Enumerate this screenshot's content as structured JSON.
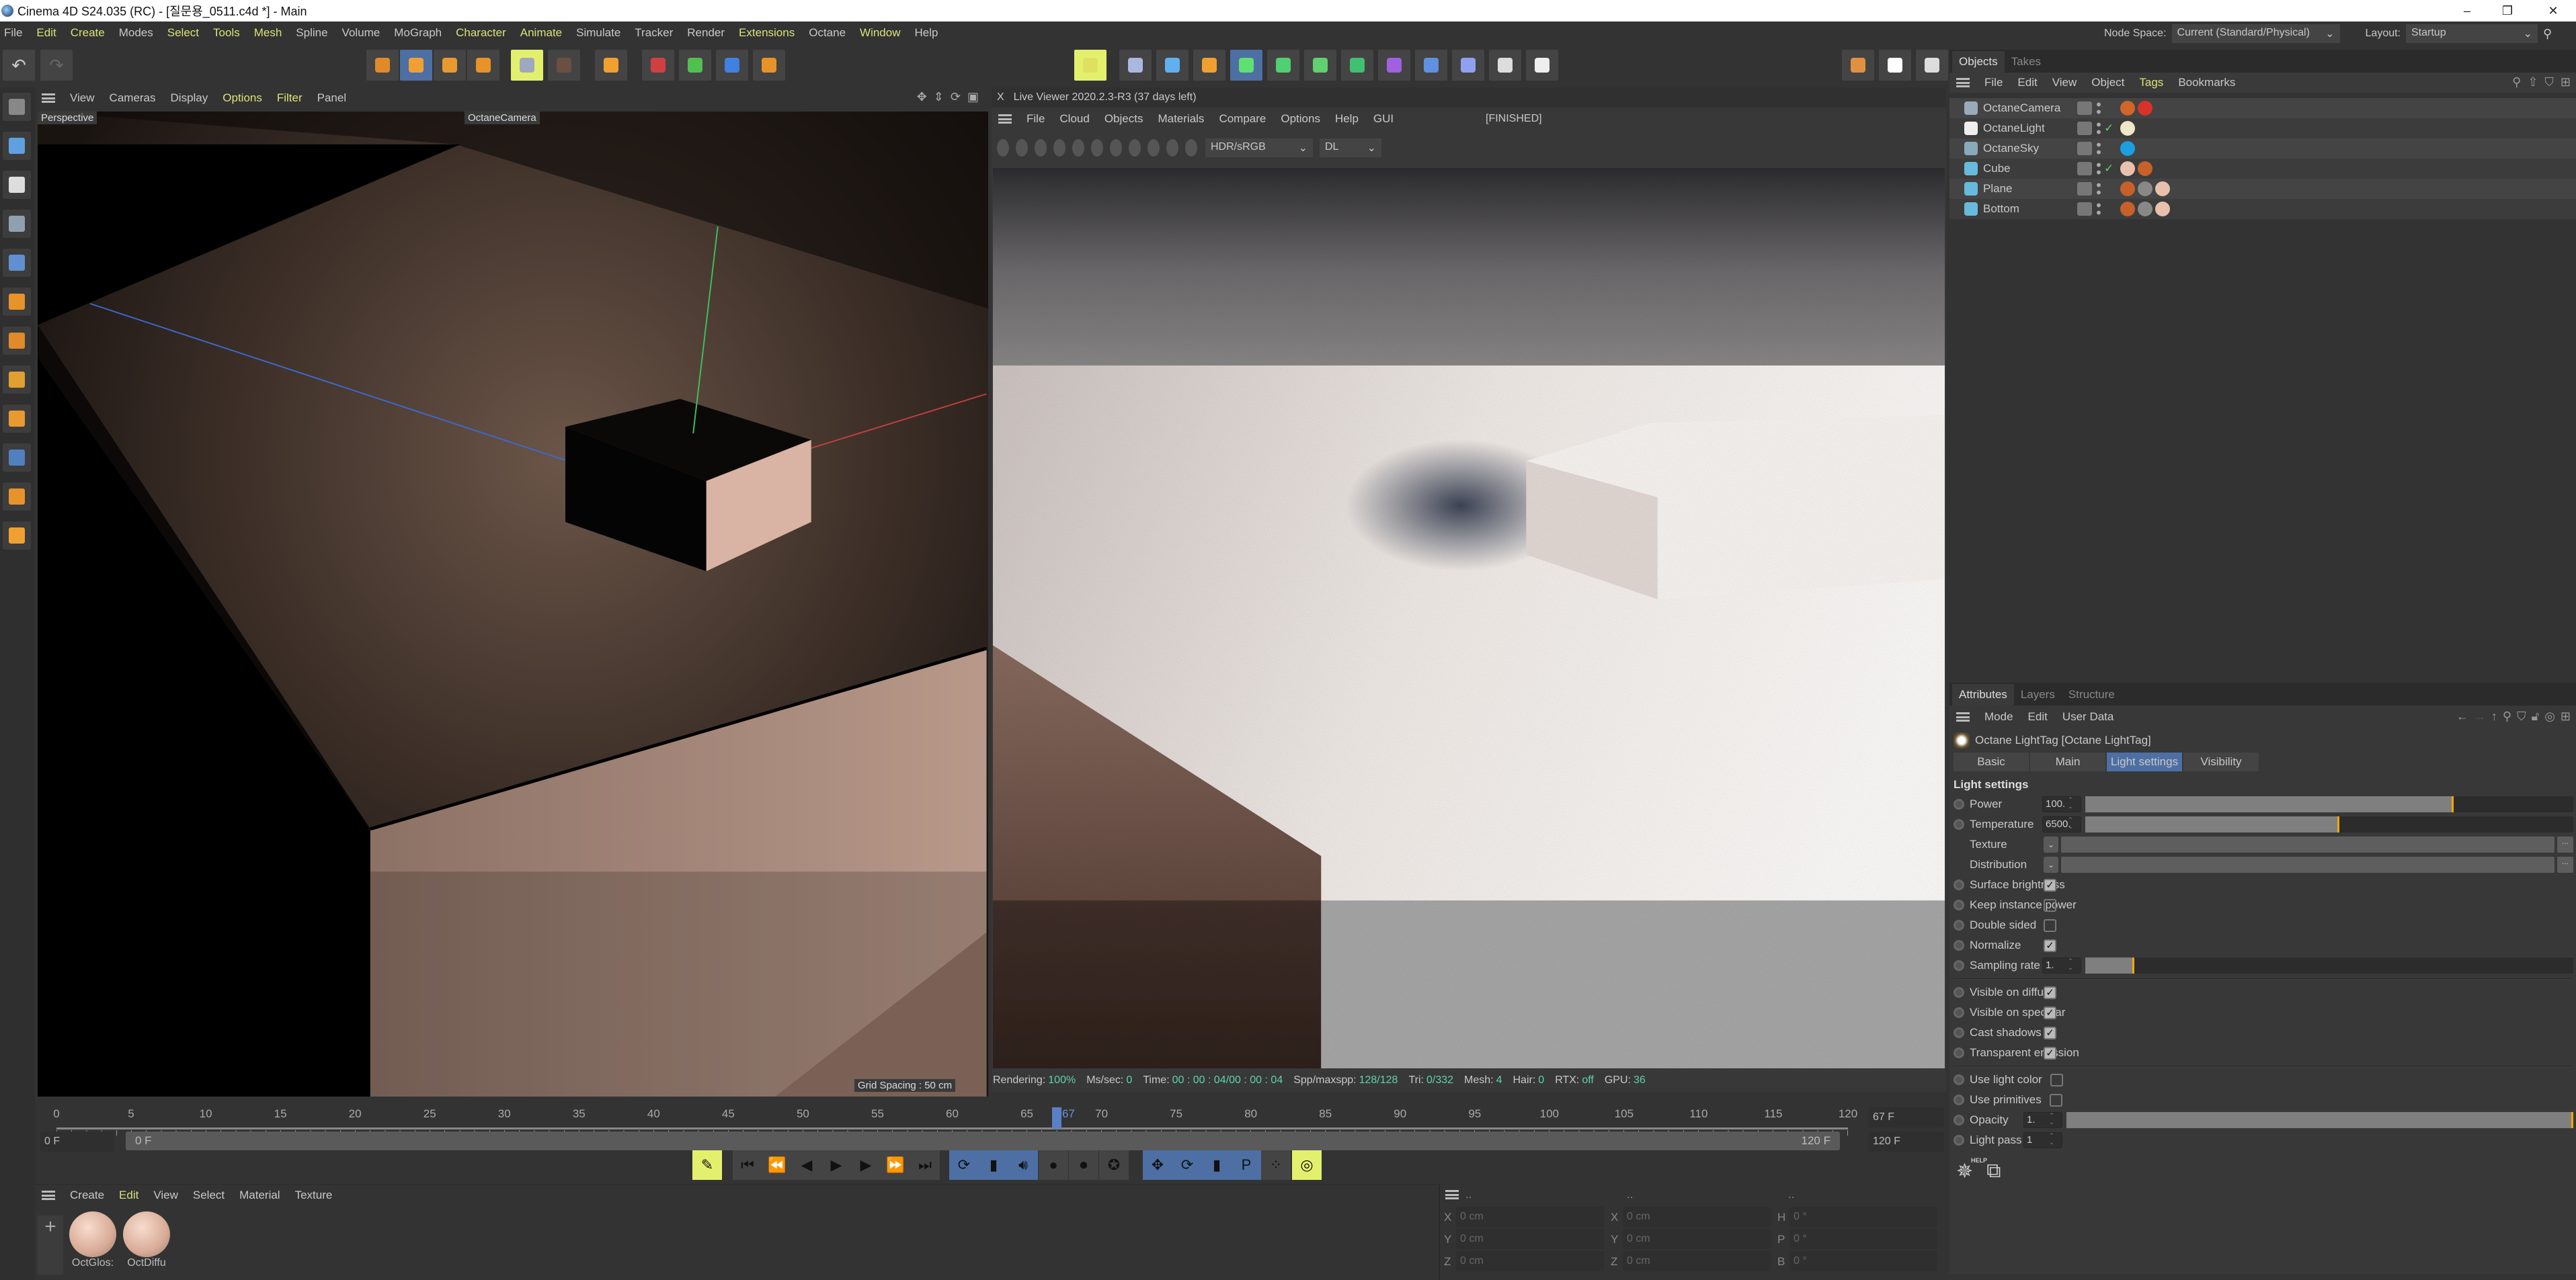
{
  "window": {
    "title": "Cinema 4D S24.035 (RC) - [질문용_0511.c4d *] - Main",
    "minimize": "–",
    "restore": "❐",
    "close": "✕"
  },
  "menu": [
    {
      "label": "File",
      "hl": false
    },
    {
      "label": "Edit",
      "hl": true
    },
    {
      "label": "Create",
      "hl": true
    },
    {
      "label": "Modes",
      "hl": false
    },
    {
      "label": "Select",
      "hl": true
    },
    {
      "label": "Tools",
      "hl": true
    },
    {
      "label": "Mesh",
      "hl": true
    },
    {
      "label": "Spline",
      "hl": false
    },
    {
      "label": "Volume",
      "hl": false
    },
    {
      "label": "MoGraph",
      "hl": false
    },
    {
      "label": "Character",
      "hl": true
    },
    {
      "label": "Animate",
      "hl": true
    },
    {
      "label": "Simulate",
      "hl": false
    },
    {
      "label": "Tracker",
      "hl": false
    },
    {
      "label": "Render",
      "hl": false
    },
    {
      "label": "Extensions",
      "hl": true
    },
    {
      "label": "Octane",
      "hl": false
    },
    {
      "label": "Window",
      "hl": true
    },
    {
      "label": "Help",
      "hl": false
    }
  ],
  "node_space": {
    "label": "Node Space:",
    "value": "Current (Standard/Physical)"
  },
  "layout": {
    "label": "Layout:",
    "value": "Startup"
  },
  "viewport": {
    "menu": [
      {
        "label": "View",
        "hl": false
      },
      {
        "label": "Cameras",
        "hl": false
      },
      {
        "label": "Display",
        "hl": false
      },
      {
        "label": "Options",
        "hl": true
      },
      {
        "label": "Filter",
        "hl": true
      },
      {
        "label": "Panel",
        "hl": false
      }
    ],
    "view_name": "Perspective",
    "camera": "OctaneCamera",
    "grid_spacing": "Grid Spacing : 50 cm"
  },
  "live_viewer": {
    "close": "X",
    "title": "Live Viewer 2020.2.3-R3 (37 days left)",
    "menu": [
      "File",
      "Cloud",
      "Objects",
      "Materials",
      "Compare",
      "Options",
      "Help",
      "GUI"
    ],
    "state": "[FINISHED]",
    "color_mode": "HDR/sRGB",
    "kernel": "DL",
    "status": [
      {
        "label": "Rendering:",
        "value": "100%"
      },
      {
        "label": "Ms/sec:",
        "value": "0"
      },
      {
        "label": "Time:",
        "value": "00 : 00 : 04/00 : 00 : 04"
      },
      {
        "label": "Spp/maxspp:",
        "value": "128/128"
      },
      {
        "label": "Tri:",
        "value": "0/332"
      },
      {
        "label": "Mesh:",
        "value": "4"
      },
      {
        "label": "Hair:",
        "value": "0"
      },
      {
        "label": "RTX:",
        "value": "off"
      },
      {
        "label": "GPU:",
        "value": "36"
      }
    ]
  },
  "objects": {
    "tabs": [
      "Objects",
      "Takes"
    ],
    "menu": [
      {
        "label": "File",
        "hl": false
      },
      {
        "label": "Edit",
        "hl": false
      },
      {
        "label": "View",
        "hl": false
      },
      {
        "label": "Object",
        "hl": false
      },
      {
        "label": "Tags",
        "hl": true
      },
      {
        "label": "Bookmarks",
        "hl": false
      }
    ],
    "items": [
      {
        "name": "OctaneCamera",
        "icon": "camera-icon",
        "color": "#9ab",
        "tags": [
          "#d0662a",
          "#d8322a"
        ],
        "check": false
      },
      {
        "name": "OctaneLight",
        "icon": "light-icon",
        "color": "#eee",
        "tags": [
          "#f0e6c8"
        ],
        "check": true
      },
      {
        "name": "OctaneSky",
        "icon": "sky-icon",
        "color": "#8ab",
        "tags": [
          "#1aa0e0"
        ],
        "check": false
      },
      {
        "name": "Cube",
        "icon": "cube-icon",
        "color": "#6bd",
        "tags": [
          "#e8c0ac",
          "#c8602a"
        ],
        "check": true
      },
      {
        "name": "Plane",
        "icon": "plane-icon",
        "color": "#6bd",
        "tags": [
          "#c8602a",
          "#888",
          "#e8c0ac"
        ],
        "check": false
      },
      {
        "name": "Bottom",
        "icon": "plane-icon",
        "color": "#6bd",
        "tags": [
          "#c8602a",
          "#888",
          "#e8c0ac"
        ],
        "check": false
      }
    ]
  },
  "attributes": {
    "tabs": [
      "Attributes",
      "Layers",
      "Structure"
    ],
    "menu": [
      "Mode",
      "Edit",
      "User Data"
    ],
    "object_title": "Octane LightTag [Octane LightTag]",
    "subtabs": [
      {
        "label": "Basic",
        "active": false
      },
      {
        "label": "Main",
        "active": false
      },
      {
        "label": "Light settings",
        "active": true
      },
      {
        "label": "Visibility",
        "active": false
      }
    ],
    "section": "Light settings",
    "groups": [
      {
        "rows": [
          {
            "label": "Power",
            "type": "slider",
            "value": "100.",
            "slider_fraction": 0.755
          },
          {
            "label": "Temperature",
            "type": "slider",
            "value": "6500.",
            "slider_fraction": 0.52
          },
          {
            "label": "Texture",
            "type": "link",
            "dots": "..."
          },
          {
            "label": "Distribution",
            "type": "link",
            "dots": "..."
          },
          {
            "label": "Surface brightness",
            "type": "check",
            "checked": true
          },
          {
            "label": "Keep instance power",
            "type": "check",
            "checked": false
          },
          {
            "label": "Double sided",
            "type": "check",
            "checked": false
          },
          {
            "label": "Normalize",
            "type": "check",
            "checked": true
          },
          {
            "label": "Sampling rate",
            "type": "slider",
            "value": "1.",
            "slider_fraction": 0.1
          }
        ]
      },
      {
        "rows": [
          {
            "label": "Visible on diffuse",
            "type": "check",
            "checked": true
          },
          {
            "label": "Visible on specular",
            "type": "check",
            "checked": true
          },
          {
            "label": "Cast shadows",
            "type": "check",
            "checked": true
          },
          {
            "label": "Transparent emission",
            "type": "check",
            "checked": true
          }
        ]
      },
      {
        "rows": [
          {
            "label": "Use light color",
            "type": "check",
            "checked": false
          },
          {
            "label": "Use primitives",
            "type": "check",
            "checked": false
          },
          {
            "label": "Opacity",
            "type": "slider",
            "value": "1.",
            "slider_fraction": 1.0
          },
          {
            "label": "Light pass ID",
            "type": "number",
            "value": "1"
          }
        ]
      }
    ],
    "help_label": "HELP"
  },
  "timeline": {
    "ticks": [
      "0",
      "5",
      "10",
      "15",
      "20",
      "25",
      "30",
      "35",
      "40",
      "45",
      "50",
      "55",
      "60",
      "65",
      "70",
      "75",
      "80",
      "85",
      "90",
      "95",
      "100",
      "105",
      "110",
      "115",
      "120"
    ],
    "current_frame": "67",
    "current_field": "67 F",
    "start_field": "0 F",
    "range_start": "0 F",
    "range_end": "120 F",
    "end_field": "120 F"
  },
  "materials": {
    "menu": [
      {
        "label": "Create",
        "hl": false
      },
      {
        "label": "Edit",
        "hl": true
      },
      {
        "label": "View",
        "hl": false
      },
      {
        "label": "Select",
        "hl": false
      },
      {
        "label": "Material",
        "hl": false
      },
      {
        "label": "Texture",
        "hl": false
      }
    ],
    "items": [
      "OctGlos:",
      "OctDiffu"
    ]
  },
  "coordinates": {
    "headers": [
      "..",
      "..",
      ".."
    ],
    "rows": [
      {
        "a": "X",
        "av": "0 cm",
        "b": "X",
        "bv": "0 cm",
        "c": "H",
        "cv": "0 °"
      },
      {
        "a": "Y",
        "av": "0 cm",
        "b": "Y",
        "bv": "0 cm",
        "c": "P",
        "cv": "0 °"
      },
      {
        "a": "Z",
        "av": "0 cm",
        "b": "Z",
        "bv": "0 cm",
        "c": "B",
        "cv": "0 °"
      }
    ]
  },
  "colors": {
    "accent_yellow": "#d9e27a",
    "active_blue": "#4d6fa3",
    "slider_thumb": "#f5a800",
    "status_value": "#5fd3a8"
  }
}
